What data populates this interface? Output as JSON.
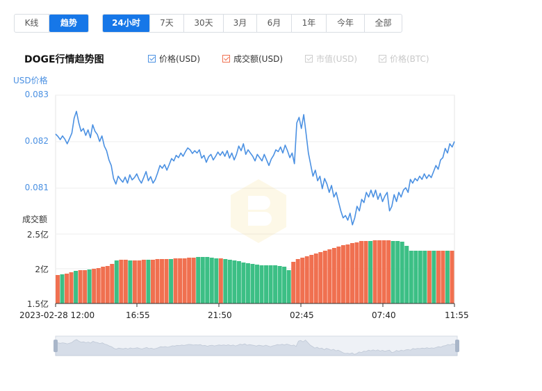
{
  "view_tabs": [
    {
      "label": "K线",
      "active": false
    },
    {
      "label": "趋势",
      "active": true
    }
  ],
  "range_tabs": [
    {
      "label": "24小时",
      "active": true
    },
    {
      "label": "7天",
      "active": false
    },
    {
      "label": "30天",
      "active": false
    },
    {
      "label": "3月",
      "active": false
    },
    {
      "label": "6月",
      "active": false
    },
    {
      "label": "1年",
      "active": false
    },
    {
      "label": "今年",
      "active": false
    },
    {
      "label": "全部",
      "active": false
    }
  ],
  "chart_title": "DOGE行情趋势图",
  "legend": [
    {
      "label": "价格(USD)",
      "checked": true,
      "enabled": true,
      "color": "#4a90e2"
    },
    {
      "label": "成交额(USD)",
      "checked": true,
      "enabled": true,
      "color": "#f07050"
    },
    {
      "label": "市值(USD)",
      "checked": true,
      "enabled": false,
      "color": "#cccccc"
    },
    {
      "label": "价格(BTC)",
      "checked": true,
      "enabled": false,
      "color": "#cccccc"
    }
  ],
  "colors": {
    "accent": "#1677e8",
    "price_line": "#4a90e2",
    "up_bar": "#f07050",
    "down_bar": "#3cbf85",
    "slider_fill": "#d6dde8"
  },
  "chart_data": {
    "type": "line",
    "x_labels": [
      "2023-02-28 12:00",
      "16:55",
      "21:50",
      "02:45",
      "07:40",
      "11:55"
    ],
    "price": {
      "ylabel": "USD价格",
      "yticks": [
        "0.083",
        "0.082",
        "0.081"
      ],
      "ylim": [
        0.08,
        0.083
      ],
      "series": [
        {
          "name": "价格(USD)",
          "values": [
            0.08216,
            0.08211,
            0.08204,
            0.08212,
            0.08205,
            0.08195,
            0.08206,
            0.08218,
            0.0825,
            0.08265,
            0.0824,
            0.08222,
            0.08228,
            0.08213,
            0.08225,
            0.08208,
            0.08236,
            0.08222,
            0.08215,
            0.082,
            0.08212,
            0.0819,
            0.0818,
            0.0816,
            0.08148,
            0.0812,
            0.08108,
            0.08125,
            0.08118,
            0.08112,
            0.08123,
            0.0811,
            0.08128,
            0.08117,
            0.08122,
            0.0813,
            0.08118,
            0.0811,
            0.08122,
            0.08135,
            0.08115,
            0.08124,
            0.0811,
            0.08118,
            0.08132,
            0.08148,
            0.08142,
            0.0815,
            0.08138,
            0.0815,
            0.08163,
            0.08158,
            0.0817,
            0.08165,
            0.08175,
            0.08168,
            0.08178,
            0.08186,
            0.08182,
            0.08174,
            0.0818,
            0.08175,
            0.08182,
            0.08164,
            0.0817,
            0.08155,
            0.08167,
            0.08172,
            0.0816,
            0.08168,
            0.08177,
            0.0817,
            0.08178,
            0.08168,
            0.0818,
            0.08164,
            0.08175,
            0.0816,
            0.08172,
            0.0819,
            0.0818,
            0.08195,
            0.08172,
            0.08182,
            0.08175,
            0.08168,
            0.08158,
            0.08172,
            0.08165,
            0.08158,
            0.08172,
            0.0816,
            0.08148,
            0.08162,
            0.0817,
            0.08182,
            0.08178,
            0.08188,
            0.08175,
            0.08192,
            0.0818,
            0.08165,
            0.08175,
            0.08152,
            0.0824,
            0.08252,
            0.08228,
            0.08258,
            0.08218,
            0.08175,
            0.0815,
            0.08125,
            0.08138,
            0.08115,
            0.08125,
            0.08098,
            0.0812,
            0.08108,
            0.0809,
            0.08105,
            0.0808,
            0.0809,
            0.0807,
            0.0805,
            0.08035,
            0.0804,
            0.0803,
            0.08045,
            0.0802,
            0.08035,
            0.0806,
            0.0805,
            0.08075,
            0.08068,
            0.0809,
            0.0808,
            0.08095,
            0.0808,
            0.08095,
            0.08075,
            0.08088,
            0.0807,
            0.08082,
            0.0809,
            0.0805,
            0.0806,
            0.08085,
            0.0807,
            0.0809,
            0.0808,
            0.08095,
            0.081,
            0.0809,
            0.08118,
            0.0811,
            0.0812,
            0.08115,
            0.08125,
            0.08118,
            0.0813,
            0.0812,
            0.08128,
            0.08122,
            0.08135,
            0.08148,
            0.0814,
            0.0816,
            0.08165,
            0.08185,
            0.08175,
            0.08195,
            0.08188,
            0.082
          ]
        }
      ]
    },
    "volume": {
      "ylabel": "成交额",
      "yticks": [
        "2.5亿",
        "2亿",
        "1.5亿"
      ],
      "ylim": [
        150000000,
        250000000
      ],
      "series": [
        {
          "name": "成交额(USD)",
          "values": [
            1.91,
            1.92,
            1.93,
            1.95,
            1.97,
            1.98,
            1.98,
            1.99,
            2.0,
            2.01,
            2.03,
            2.04,
            2.07,
            2.12,
            2.13,
            2.13,
            2.12,
            2.12,
            2.12,
            2.13,
            2.13,
            2.13,
            2.14,
            2.14,
            2.14,
            2.14,
            2.15,
            2.15,
            2.15,
            2.16,
            2.16,
            2.17,
            2.17,
            2.17,
            2.16,
            2.15,
            2.15,
            2.14,
            2.13,
            2.12,
            2.11,
            2.09,
            2.08,
            2.07,
            2.06,
            2.05,
            2.05,
            2.05,
            2.05,
            2.04,
            2.03,
            1.98,
            2.1,
            2.14,
            2.16,
            2.18,
            2.2,
            2.22,
            2.24,
            2.26,
            2.28,
            2.3,
            2.32,
            2.34,
            2.35,
            2.37,
            2.38,
            2.4,
            2.4,
            2.4,
            2.41,
            2.41,
            2.41,
            2.41,
            2.4,
            2.4,
            2.39,
            2.33,
            2.26,
            2.26,
            2.26,
            2.26,
            2.26,
            2.26,
            2.26,
            2.26,
            2.26,
            2.26
          ],
          "up": [
            1,
            0,
            1,
            1,
            0,
            1,
            1,
            0,
            1,
            1,
            1,
            1,
            1,
            0,
            1,
            1,
            0,
            1,
            1,
            1,
            0,
            1,
            1,
            1,
            1,
            0,
            1,
            1,
            1,
            1,
            1,
            0,
            0,
            0,
            0,
            0,
            1,
            0,
            0,
            0,
            0,
            0,
            0,
            0,
            0,
            0,
            0,
            0,
            0,
            0,
            0,
            0,
            1,
            1,
            1,
            1,
            1,
            1,
            1,
            1,
            1,
            1,
            1,
            1,
            1,
            1,
            1,
            1,
            1,
            0,
            1,
            1,
            1,
            1,
            0,
            0,
            0,
            0,
            0,
            0,
            0,
            0,
            1,
            0,
            1,
            1,
            0,
            1
          ]
        }
      ]
    },
    "grid": true,
    "legend_position": "top"
  },
  "slider": {
    "handles": [
      "left",
      "right"
    ]
  }
}
